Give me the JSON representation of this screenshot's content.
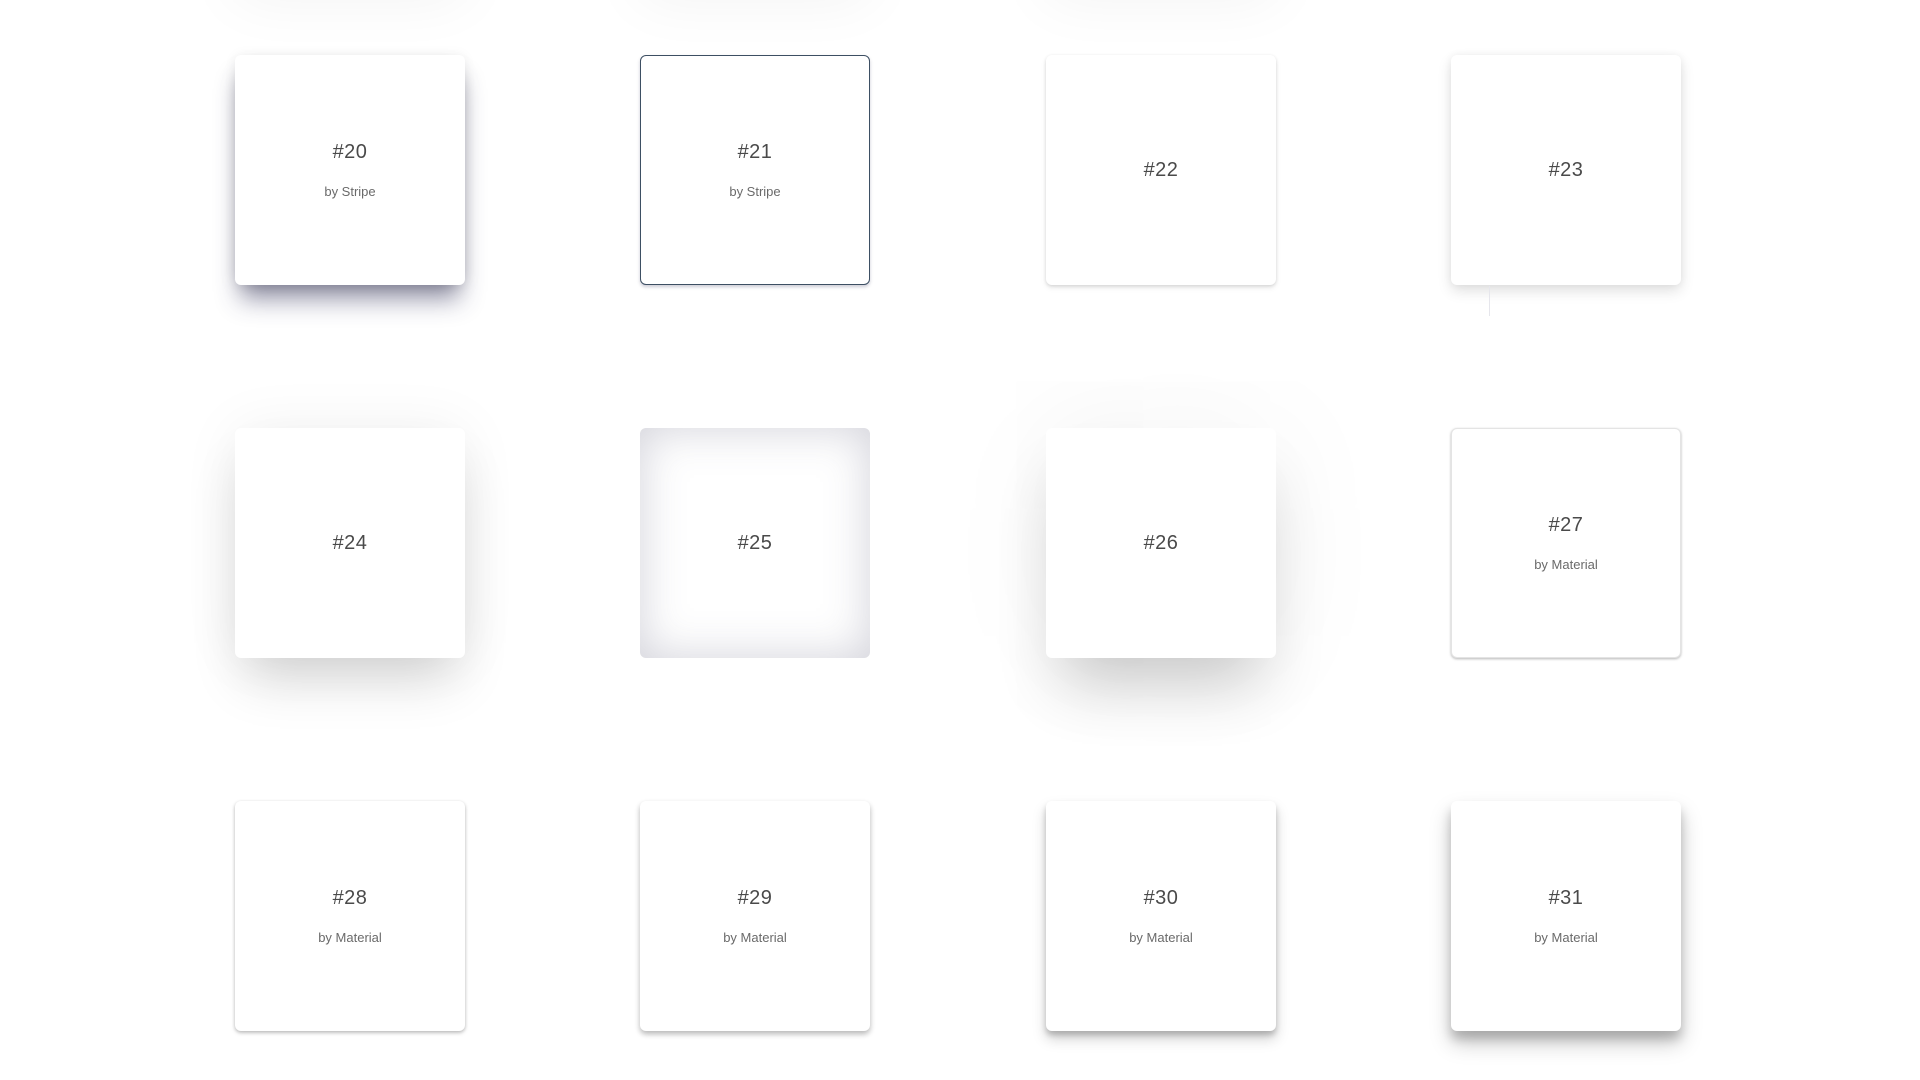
{
  "gallery": {
    "cards": [
      {
        "num": "#20",
        "by": "by Stripe"
      },
      {
        "num": "#21",
        "by": "by Stripe"
      },
      {
        "num": "#22",
        "by": ""
      },
      {
        "num": "#23",
        "by": ""
      },
      {
        "num": "#24",
        "by": ""
      },
      {
        "num": "#25",
        "by": ""
      },
      {
        "num": "#26",
        "by": ""
      },
      {
        "num": "#27",
        "by": "by Material"
      },
      {
        "num": "#28",
        "by": "by Material"
      },
      {
        "num": "#29",
        "by": "by Material"
      },
      {
        "num": "#30",
        "by": "by Material"
      },
      {
        "num": "#31",
        "by": "by Material"
      }
    ]
  },
  "colors": {
    "background": "#ffffff",
    "card": "#ffffff",
    "text": "#4a4a4a",
    "subtext": "#6a6a6a",
    "selected_border": "#3d4f63"
  }
}
